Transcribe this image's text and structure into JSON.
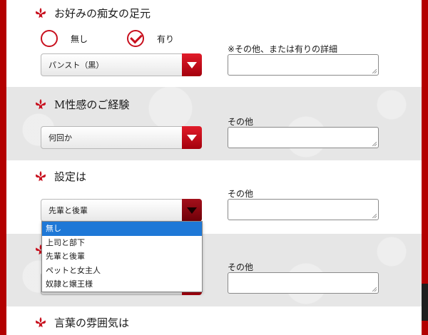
{
  "colors": {
    "frame": "#b30000",
    "accent": "#c8101e",
    "highlight": "#1e78d7"
  },
  "sections": [
    {
      "heading": "お好みの痴女の足元",
      "radios": [
        {
          "label": "無し",
          "checked": false
        },
        {
          "label": "有り",
          "checked": true
        }
      ],
      "select_value": "パンスト（黒）",
      "field_label": "※その他、または有りの詳細",
      "textarea_value": ""
    },
    {
      "heading": "M性感のご経験",
      "select_value": "何回か",
      "field_label": "その他",
      "textarea_value": ""
    },
    {
      "heading": "設定は",
      "select_value": "先輩と後輩",
      "field_label": "その他",
      "textarea_value": "",
      "dropdown_open": true,
      "options": [
        "無し",
        "上司と部下",
        "先輩と後輩",
        "ペットと女主人",
        "奴隷と嬢王様"
      ],
      "highlighted_option": "無し"
    },
    {
      "field_label": "その他",
      "textarea_value": ""
    },
    {
      "heading": "言葉の雰囲気は"
    }
  ]
}
